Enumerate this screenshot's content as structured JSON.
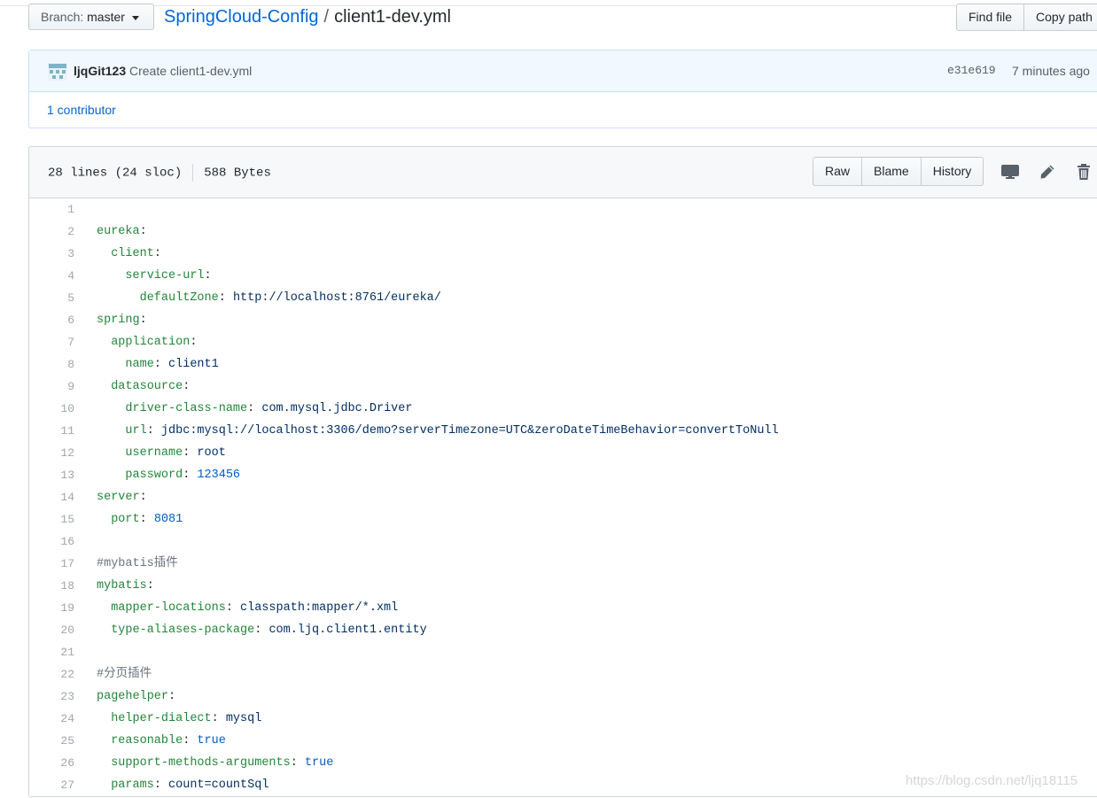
{
  "branch": {
    "label": "Branch:",
    "value": "master"
  },
  "breadcrumb": {
    "repo": "SpringCloud-Config",
    "separator": "/",
    "file": "client1-dev.yml"
  },
  "top_buttons": {
    "find_file": "Find file",
    "copy_path": "Copy path"
  },
  "commit": {
    "author": "ljqGit123",
    "message": "Create client1-dev.yml",
    "sha": "e31e619",
    "time": "7 minutes ago",
    "contributors": "1 contributor"
  },
  "file_info": {
    "lines": "28 lines (24 sloc)",
    "size": "588 Bytes"
  },
  "file_buttons": {
    "raw": "Raw",
    "blame": "Blame",
    "history": "History"
  },
  "icons": [
    "desktop-icon",
    "pencil-icon",
    "trash-icon"
  ],
  "code_lines": [
    {
      "num": "1",
      "indent": "",
      "key": "",
      "sep": "",
      "val": "",
      "vtype": ""
    },
    {
      "num": "2",
      "indent": "",
      "key": "eureka",
      "sep": ":",
      "val": "",
      "vtype": ""
    },
    {
      "num": "3",
      "indent": "  ",
      "key": "client",
      "sep": ":",
      "val": "",
      "vtype": ""
    },
    {
      "num": "4",
      "indent": "    ",
      "key": "service-url",
      "sep": ":",
      "val": "",
      "vtype": ""
    },
    {
      "num": "5",
      "indent": "      ",
      "key": "defaultZone",
      "sep": ": ",
      "val": "http://localhost:8761/eureka/",
      "vtype": "s"
    },
    {
      "num": "6",
      "indent": "",
      "key": "spring",
      "sep": ":",
      "val": "",
      "vtype": ""
    },
    {
      "num": "7",
      "indent": "  ",
      "key": "application",
      "sep": ":",
      "val": "",
      "vtype": ""
    },
    {
      "num": "8",
      "indent": "    ",
      "key": "name",
      "sep": ": ",
      "val": "client1",
      "vtype": "s"
    },
    {
      "num": "9",
      "indent": "  ",
      "key": "datasource",
      "sep": ":",
      "val": "",
      "vtype": ""
    },
    {
      "num": "10",
      "indent": "    ",
      "key": "driver-class-name",
      "sep": ": ",
      "val": "com.mysql.jdbc.Driver",
      "vtype": "s"
    },
    {
      "num": "11",
      "indent": "    ",
      "key": "url",
      "sep": ": ",
      "val": "jdbc:mysql://localhost:3306/demo?serverTimezone=UTC&zeroDateTimeBehavior=convertToNull",
      "vtype": "s"
    },
    {
      "num": "12",
      "indent": "    ",
      "key": "username",
      "sep": ": ",
      "val": "root",
      "vtype": "s"
    },
    {
      "num": "13",
      "indent": "    ",
      "key": "password",
      "sep": ": ",
      "val": "123456",
      "vtype": "n"
    },
    {
      "num": "14",
      "indent": "",
      "key": "server",
      "sep": ":",
      "val": "",
      "vtype": ""
    },
    {
      "num": "15",
      "indent": "  ",
      "key": "port",
      "sep": ": ",
      "val": "8081",
      "vtype": "n"
    },
    {
      "num": "16",
      "indent": "",
      "key": "",
      "sep": "",
      "val": "",
      "vtype": ""
    },
    {
      "num": "17",
      "indent": "",
      "key": "",
      "sep": "",
      "val": "#mybatis插件",
      "vtype": "c"
    },
    {
      "num": "18",
      "indent": "",
      "key": "mybatis",
      "sep": ":",
      "val": "",
      "vtype": ""
    },
    {
      "num": "19",
      "indent": "  ",
      "key": "mapper-locations",
      "sep": ": ",
      "val": "classpath:mapper/*.xml",
      "vtype": "s"
    },
    {
      "num": "20",
      "indent": "  ",
      "key": "type-aliases-package",
      "sep": ": ",
      "val": "com.ljq.client1.entity",
      "vtype": "s"
    },
    {
      "num": "21",
      "indent": "",
      "key": "",
      "sep": "",
      "val": "",
      "vtype": ""
    },
    {
      "num": "22",
      "indent": "",
      "key": "",
      "sep": "",
      "val": "#分页插件",
      "vtype": "c"
    },
    {
      "num": "23",
      "indent": "",
      "key": "pagehelper",
      "sep": ":",
      "val": "",
      "vtype": ""
    },
    {
      "num": "24",
      "indent": "  ",
      "key": "helper-dialect",
      "sep": ": ",
      "val": "mysql",
      "vtype": "s"
    },
    {
      "num": "25",
      "indent": "  ",
      "key": "reasonable",
      "sep": ": ",
      "val": "true",
      "vtype": "n"
    },
    {
      "num": "26",
      "indent": "  ",
      "key": "support-methods-arguments",
      "sep": ": ",
      "val": "true",
      "vtype": "n"
    },
    {
      "num": "27",
      "indent": "  ",
      "key": "params",
      "sep": ": ",
      "val": "count=countSql",
      "vtype": "s"
    }
  ],
  "watermark": "https://blog.csdn.net/ljq18115"
}
